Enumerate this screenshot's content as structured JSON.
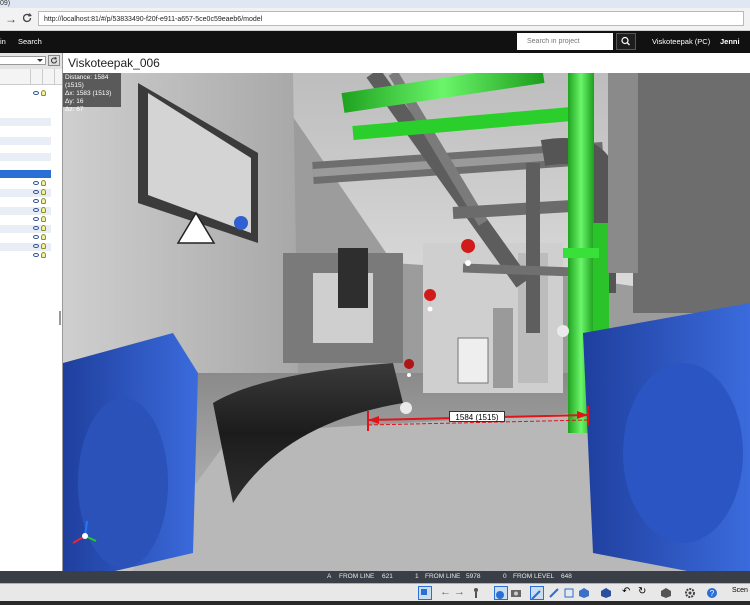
{
  "browser": {
    "tab_fragment": "09)",
    "url": "http://localhost:81/#/p/53833490-f20f-e911-a657-5ce0c59eaeb6/model"
  },
  "header": {
    "nav_partial": "in",
    "nav_search": "Search",
    "search_placeholder": "Search in project",
    "project": "Viskoteepak (PC)",
    "user_partial": "Jenni Tu"
  },
  "viewer": {
    "title": "Viskoteepak_006",
    "measure": {
      "distance": "Distance: 1584 (1515)",
      "dx": "Δx: 1583 (1513)",
      "dy": "Δy: 16",
      "dz": "Δz: 67"
    },
    "distance_label": "1584 (1515)"
  },
  "status": {
    "a_label": "A",
    "a_text": "FROM LINE",
    "a_value": "621",
    "b_label": "1",
    "b_text": "FROM LINE",
    "b_value": "5978",
    "c_label": "0",
    "c_text": "FROM LEVEL",
    "c_value": "648"
  },
  "toolbar": {
    "scene_partial": "Scen"
  },
  "colors": {
    "selection": "#2a6fd6",
    "pipe_green": "#3ddc3d",
    "equipment_blue": "#2f5fd0",
    "measure_red": "#e0141a"
  }
}
